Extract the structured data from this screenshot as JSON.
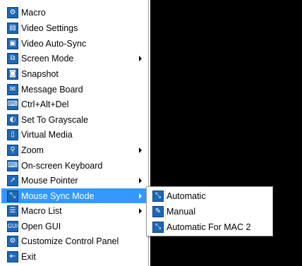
{
  "context_menu": {
    "items": [
      {
        "label": "Macro",
        "glyph": "⚙",
        "submenu": false
      },
      {
        "label": "Video Settings",
        "glyph": "▤",
        "submenu": false
      },
      {
        "label": "Video Auto-Sync",
        "glyph": "▣",
        "submenu": false
      },
      {
        "label": "Screen Mode",
        "glyph": "⧉",
        "submenu": true
      },
      {
        "label": "Snapshot",
        "glyph": "◙",
        "submenu": false
      },
      {
        "label": "Message Board",
        "glyph": "✉",
        "submenu": false
      },
      {
        "label": "Ctrl+Alt+Del",
        "glyph": "⌨",
        "submenu": false
      },
      {
        "label": "Set To Grayscale",
        "glyph": "◐",
        "submenu": false
      },
      {
        "label": "Virtual Media",
        "glyph": "▯",
        "submenu": false
      },
      {
        "label": "Zoom",
        "glyph": "⚲",
        "submenu": true
      },
      {
        "label": "On-screen Keyboard",
        "glyph": "⌨",
        "submenu": false
      },
      {
        "label": "Mouse Pointer",
        "glyph": "➚",
        "submenu": true
      },
      {
        "label": "Mouse Sync Mode",
        "glyph": "⤡",
        "submenu": true,
        "selected": true
      },
      {
        "label": "Macro List",
        "glyph": "☰",
        "submenu": true
      },
      {
        "label": "Open GUI",
        "glyph": "GUI",
        "submenu": false
      },
      {
        "label": "Customize Control Panel",
        "glyph": "⚙",
        "submenu": false
      },
      {
        "label": "Exit",
        "glyph": "⇤",
        "submenu": false
      }
    ]
  },
  "mouse_sync_submenu": {
    "items": [
      {
        "label": "Automatic",
        "glyph": "⤡"
      },
      {
        "label": "Manual",
        "glyph": "✎"
      },
      {
        "label": "Automatic For MAC 2",
        "glyph": "⤡"
      }
    ]
  },
  "colors": {
    "highlight": "#3399ff",
    "icon_blue": "#1c67b8",
    "remote_screen": "#000000"
  }
}
